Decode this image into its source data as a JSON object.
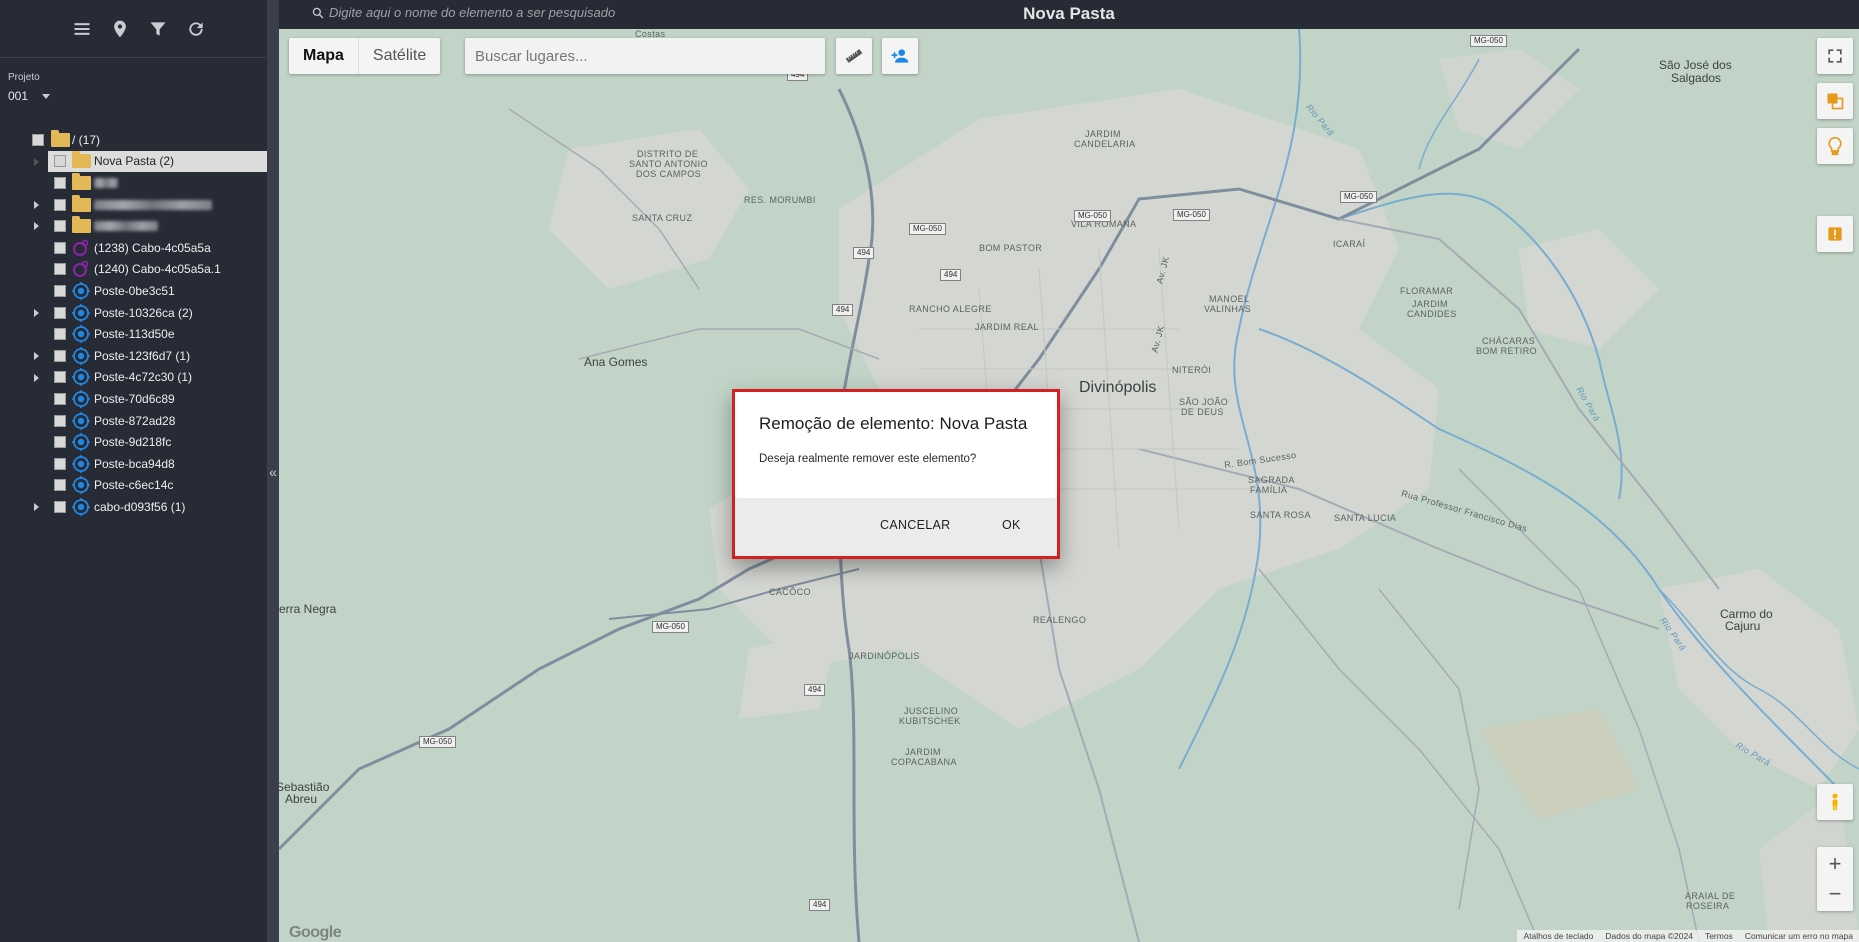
{
  "header": {
    "element_search_placeholder": "Digite aqui o nome do elemento a ser pesquisado",
    "title": "Nova Pasta"
  },
  "sidebar": {
    "toolbar": [
      "menu-icon",
      "map-pin-icon",
      "filter-icon",
      "refresh-icon"
    ],
    "project_label": "Projeto",
    "project_value": "001",
    "root": "/ (17)",
    "items": [
      {
        "label": "Nova Pasta (2)",
        "type": "folder",
        "expandable": true,
        "selected": true
      },
      {
        "label": "",
        "type": "folder",
        "expandable": false,
        "redacted": true
      },
      {
        "label": "",
        "type": "folder",
        "expandable": true,
        "redacted": true
      },
      {
        "label": "",
        "type": "folder",
        "expandable": true,
        "redacted": true
      },
      {
        "label": "(1238) Cabo-4c05a5a",
        "type": "cable",
        "expandable": false
      },
      {
        "label": "(1240) Cabo-4c05a5a.1",
        "type": "cable",
        "expandable": false
      },
      {
        "label": "Poste-0be3c51",
        "type": "pole",
        "expandable": false
      },
      {
        "label": "Poste-10326ca (2)",
        "type": "pole",
        "expandable": true
      },
      {
        "label": "Poste-113d50e",
        "type": "pole",
        "expandable": false
      },
      {
        "label": "Poste-123f6d7 (1)",
        "type": "pole",
        "expandable": true
      },
      {
        "label": "Poste-4c72c30 (1)",
        "type": "pole",
        "expandable": true
      },
      {
        "label": "Poste-70d6c89",
        "type": "pole",
        "expandable": false
      },
      {
        "label": "Poste-872ad28",
        "type": "pole",
        "expandable": false
      },
      {
        "label": "Poste-9d218fc",
        "type": "pole",
        "expandable": false
      },
      {
        "label": "Poste-bca94d8",
        "type": "pole",
        "expandable": false
      },
      {
        "label": "Poste-c6ec14c",
        "type": "pole",
        "expandable": false
      },
      {
        "label": "cabo-d093f56 (1)",
        "type": "pole",
        "expandable": true
      }
    ],
    "collapse_label": "«"
  },
  "map": {
    "tabs": {
      "map": "Mapa",
      "satellite": "Satélite"
    },
    "places_placeholder": "Buscar lugares...",
    "labels": {
      "city": "Divinópolis",
      "ana_gomes": "Ana Gomes",
      "serra_negra": "erra Negra",
      "sao_jose_1": "São José dos",
      "sao_jose_2": "Salgados",
      "carmo_1": "Carmo do",
      "carmo_2": "Cajuru",
      "sebastiao_1": "Sebastião",
      "sebastiao_2": "Abreu",
      "distrito_1": "DISTRITO DE",
      "distrito_2": "SANTO ANTONIO",
      "distrito_3": "DOS CAMPOS",
      "santa_cruz": "SANTA CRUZ",
      "res_morumbi": "RES. MORUMBI",
      "jardim_candelaria_1": "JARDIM",
      "jardim_candelaria_2": "CANDELARIA",
      "vila_romana": "VILA ROMANA",
      "bom_pastor": "BOM PASTOR",
      "icarai": "ICARAÍ",
      "floramar": "FLORAMAR",
      "jardim_candides_1": "JARDIM",
      "jardim_candides_2": "CANDIDES",
      "chacaras_1": "CHÁCARAS",
      "chacaras_2": "BOM RETIRO",
      "rancho_alegre": "RANCHO ALEGRE",
      "jardim_real": "JARDIM REAL",
      "manoel_1": "MANOEL",
      "manoel_2": "VALINHAS",
      "niteroi": "NITERÓI",
      "sao_joao_1": "SÃO JOÃO",
      "sao_joao_2": "DE DEUS",
      "r_bom_sucesso": "R. Bom Sucesso",
      "sagrada_1": "SAGRADA",
      "sagrada_2": "FAMÍLIA",
      "rua_prof": "Rua Professor Francisco Dias",
      "santa_rosa": "SANTA ROSA",
      "santa_lucia": "SANTA LUCIA",
      "cacoco": "CACÔCO",
      "realengo": "REALENGO",
      "jardinopolis": "JARDINÓPOLIS",
      "juscelino_1": "JUSCELINO",
      "juscelino_2": "KUBITSCHEK",
      "copacabana_1": "JARDIM",
      "copacabana_2": "COPACABANA",
      "araial_1": "ARAIAL DE",
      "araial_2": "ROSEIRA",
      "rio_para": "Rio Pará",
      "av_jk": "Av. JK",
      "costas": "Costas"
    },
    "shields": [
      "MG-050",
      "494"
    ],
    "footer": [
      "Atalhos de teclado",
      "Dados do mapa ©2024",
      "Termos",
      "Comunicar um erro no mapa"
    ],
    "google_logo": "Google",
    "zoom_in": "+",
    "zoom_out": "−"
  },
  "dialog": {
    "title": "Remoção de elemento: Nova Pasta",
    "message": "Deseja realmente remover este elemento?",
    "cancel": "CANCELAR",
    "ok": "OK",
    "border_color": "#d42020"
  },
  "colors": {
    "sidebar_bg": "#272b35",
    "folder": "#e3b958",
    "pole_icon": "#1e88e5",
    "cable_icon": "#8e24aa",
    "map_bg": "#cfe2d4"
  }
}
